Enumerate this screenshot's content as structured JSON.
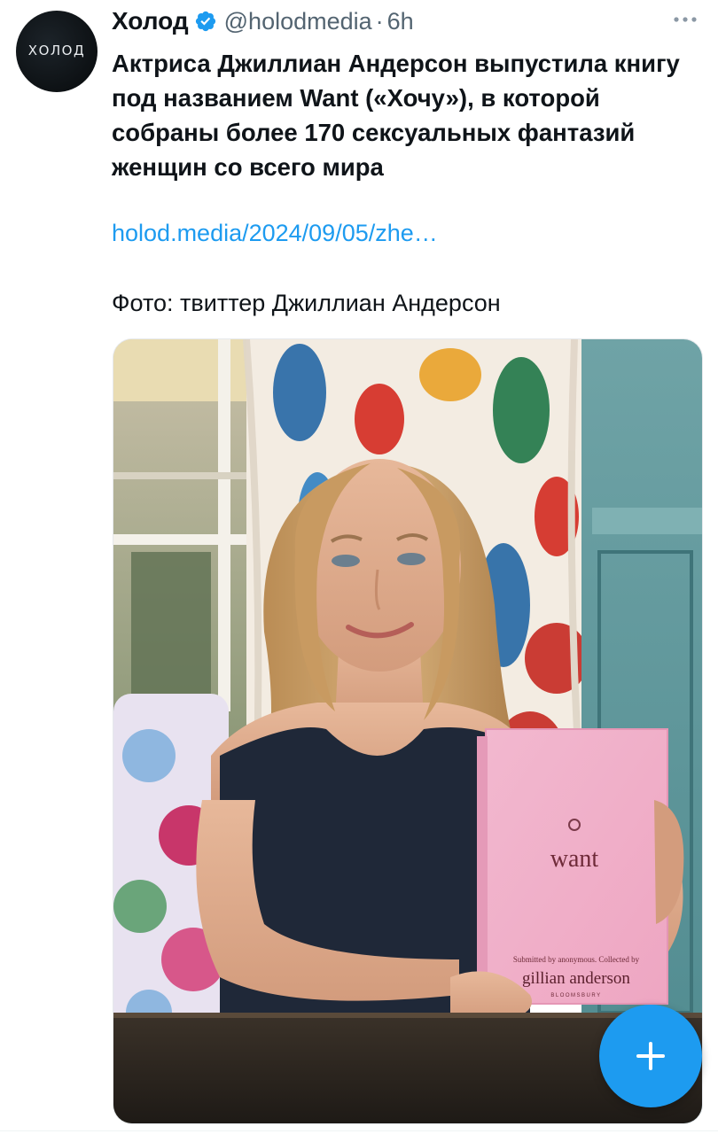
{
  "author": {
    "display_name": "Холод",
    "avatar_text": "ХОЛОД",
    "handle": "@holodmedia",
    "separator": "·",
    "time": "6h",
    "verified_icon": "verified-badge-icon"
  },
  "tweet": {
    "text": "Актриса Джиллиан Андерсон выпустила книгу под названием Want («Хочу»), в которой собраны более 170 сексуальных фантазий женщин со всего мира",
    "link": "holod.media/2024/09/05/zhe…",
    "photo_credit": "Фото: твиттер Джиллиан Андерсон"
  },
  "media": {
    "book": {
      "title": "want",
      "subline": "Submitted by anonymous. Collected by",
      "author": "gillian anderson",
      "publisher": "BLOOMSBURY"
    }
  },
  "colors": {
    "link": "#1d9bf0",
    "secondary_text": "#536471",
    "fab": "#1d9bf0"
  }
}
